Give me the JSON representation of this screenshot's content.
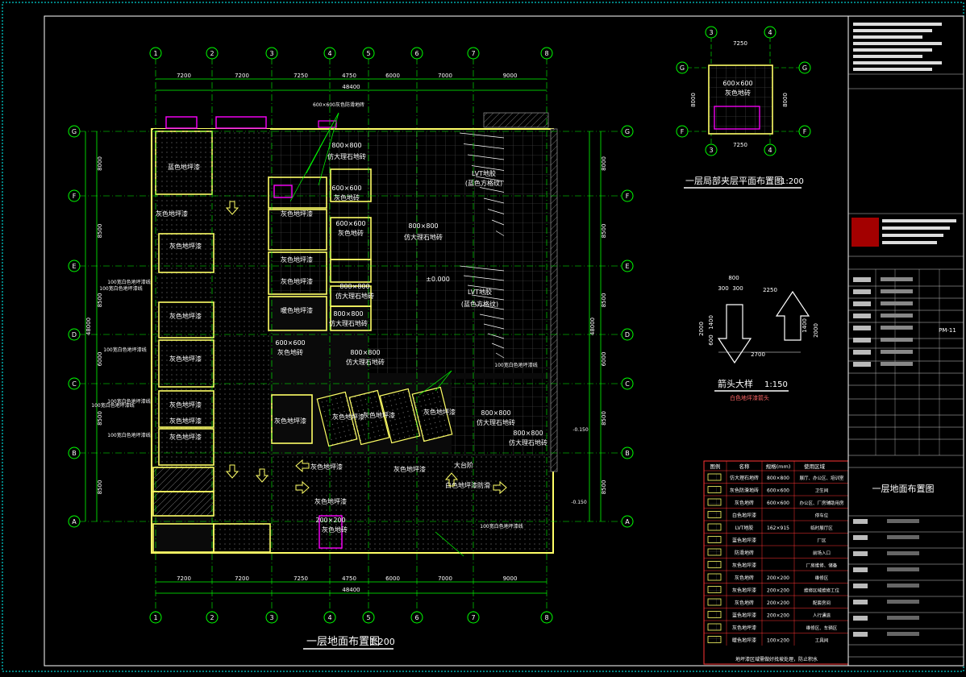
{
  "main": {
    "title": "一层地面布置图",
    "scale": "1:200",
    "grid_cols": [
      "1",
      "2",
      "3",
      "4",
      "5",
      "6",
      "7",
      "8"
    ],
    "grid_rows": [
      "G",
      "F",
      "E",
      "D",
      "C",
      "B",
      "A"
    ],
    "top_dims": [
      "7200",
      "7200",
      "7250",
      "4750",
      "6000",
      "7000",
      "9000"
    ],
    "total_width": "48400",
    "left_dims": [
      "8000",
      "8500",
      "8500",
      "6000",
      "8500",
      "8500"
    ],
    "total_height": "48000",
    "rooms": [
      "蓝色地坪漆",
      "灰色地坪漆",
      "灰色地坪漆",
      "灰色地坪漆",
      "灰色地坪漆",
      "灰色地坪漆",
      "灰色地坪漆",
      "灰色地坪漆",
      "灰色地坪漆",
      "灰色地坪漆",
      "暖色地坪漆",
      "800×800",
      "仿大理石地砖",
      "600×600",
      "灰色地砖",
      "600×600",
      "灰色地砖",
      "800×800",
      "仿大理石地砖",
      "LVT地胶",
      "(蓝色方格纹)",
      "LVT地胶",
      "(蓝色方格纹)",
      "800×800",
      "仿大理石地砖",
      "800×800",
      "仿大理石地砖",
      "800×800",
      "仿大理石地砖",
      "600×600",
      "灰色地砖",
      "800×800",
      "仿大理石地砖",
      "800×800",
      "仿大理石地砖",
      "灰色地坪漆",
      "灰色地坪漆",
      "灰色地坪漆",
      "灰色地坪漆",
      "灰色地坪漆",
      "灰色地坪漆",
      "大台阶",
      "白色地坪漆防滑",
      "灰色地坪漆",
      "灰色地坪漆",
      "200×200",
      "灰色地砖",
      "±0.000"
    ],
    "notes": [
      "100宽白色地坪漆线",
      "100宽白色地坪漆线",
      "100宽白色地坪漆线",
      "100宽白色地坪漆线",
      "100宽白色地坪漆线",
      "100宽白色地坪漆线",
      "100宽白色地坪漆线",
      "100宽白色地坪漆线",
      "600×600灰色防滑地砖",
      "-0.150",
      "-0.150"
    ]
  },
  "mezz": {
    "title": "一层局部夹层平面布置图",
    "scale": "1:200",
    "cols": [
      "3",
      "4"
    ],
    "rows": [
      "G",
      "F"
    ],
    "dim_w": "7250",
    "dim_h": "8000",
    "room": [
      "600×600",
      "灰色地砖"
    ]
  },
  "arrow_detail": {
    "title": "箭头大样",
    "scale": "1:150",
    "subtitle": "白色地坪漆箭头",
    "dims": [
      "800",
      "300",
      "300",
      "2250",
      "2000",
      "1400",
      "600",
      "2700",
      "1400",
      "2000"
    ]
  },
  "legend": {
    "headers": [
      "图例",
      "名称",
      "规格(mm)",
      "使用区域"
    ],
    "rows": [
      [
        "仿大理石地砖",
        "800×800",
        "展厅、办公区、培训室"
      ],
      [
        "灰色防滑地砖",
        "600×600",
        "卫生间"
      ],
      [
        "灰色地砖",
        "600×600",
        "办公区、厂房辅助用房"
      ],
      [
        "白色地坪漆",
        "",
        "停车位"
      ],
      [
        "LVT地胶",
        "162×915",
        "临时展厅区"
      ],
      [
        "蓝色地坪漆",
        "",
        "厂区"
      ],
      [
        "防滑地砖",
        "",
        "前场入口"
      ],
      [
        "灰色地坪漆",
        "",
        "厂房维修、储备"
      ],
      [
        "灰色地砖",
        "200×200",
        "维修区"
      ],
      [
        "灰色地坪漆",
        "200×200",
        "维修区域维修工位"
      ],
      [
        "灰色地砖",
        "200×200",
        "配套房间"
      ],
      [
        "蓝色地坪漆",
        "200×200",
        "人行通道"
      ],
      [
        "灰色地坪漆",
        "",
        "维修区、车辆区"
      ],
      [
        "暖色地坪漆",
        "100×200",
        "工具间"
      ]
    ],
    "footnote": "地坪漆区域需做好找坡处理，防止积水"
  },
  "title_block": {
    "drawing_name": "一层地面布置图",
    "drawing_no": "PM-11"
  },
  "colors": {
    "grid": "#00ff00",
    "wall": "#ffff66",
    "frame": "#00ffff",
    "text": "#ffffff",
    "accent": "#ff00ff",
    "stair": "#ff3366"
  }
}
